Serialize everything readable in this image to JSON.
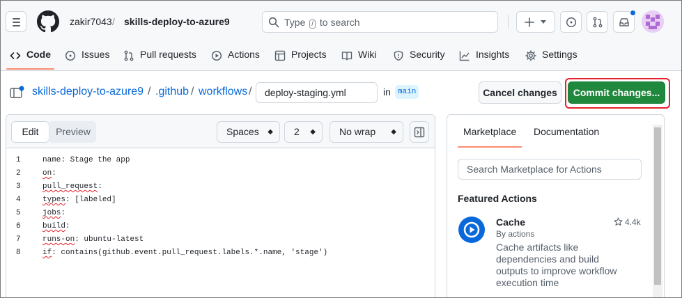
{
  "header": {
    "owner": "zakir7043",
    "separator": "/",
    "repo": "skills-deploy-to-azure9",
    "search_prefix": "Type",
    "search_key": "/",
    "search_suffix": "to search"
  },
  "repo_nav": {
    "items": [
      {
        "label": "Code",
        "icon": "code-icon"
      },
      {
        "label": "Issues",
        "icon": "issue-icon"
      },
      {
        "label": "Pull requests",
        "icon": "pull-request-icon"
      },
      {
        "label": "Actions",
        "icon": "play-icon"
      },
      {
        "label": "Projects",
        "icon": "table-icon"
      },
      {
        "label": "Wiki",
        "icon": "book-icon"
      },
      {
        "label": "Security",
        "icon": "shield-icon"
      },
      {
        "label": "Insights",
        "icon": "graph-icon"
      },
      {
        "label": "Settings",
        "icon": "gear-icon"
      }
    ]
  },
  "path": {
    "repo": "skills-deploy-to-azure9",
    "sep": "/",
    "dir1": ".github",
    "dir2": "workflows",
    "filename": "deploy-staging.yml",
    "in_label": "in",
    "branch": "main"
  },
  "actions": {
    "cancel": "Cancel changes",
    "commit": "Commit changes..."
  },
  "editor": {
    "tab_edit": "Edit",
    "tab_preview": "Preview",
    "indent_mode": "Spaces",
    "indent_size": "2",
    "wrap_mode": "No wrap",
    "lines": [
      {
        "num": "1",
        "pre": "name: Stage the app",
        "err": "",
        "post": ""
      },
      {
        "num": "2",
        "pre": "",
        "err": "on",
        "post": ":"
      },
      {
        "num": "3",
        "pre": "",
        "err": "pull_request",
        "post": ":"
      },
      {
        "num": "4",
        "pre": "",
        "err": "types",
        "post": ": [labeled]"
      },
      {
        "num": "5",
        "pre": "",
        "err": "jobs",
        "post": ":"
      },
      {
        "num": "6",
        "pre": "",
        "err": "build",
        "post": ":"
      },
      {
        "num": "7",
        "pre": "",
        "err": "runs-on",
        "post": ": ubuntu-latest"
      },
      {
        "num": "8",
        "pre": "",
        "err": "if",
        "post": ": contains(github.event.pull_request.labels.*.name, 'stage')"
      }
    ]
  },
  "panel": {
    "tab_marketplace": "Marketplace",
    "tab_documentation": "Documentation",
    "search_placeholder": "Search Marketplace for Actions",
    "featured_heading": "Featured Actions",
    "featured": {
      "title": "Cache",
      "by": "By actions",
      "stars": "4.4k",
      "description": "Cache artifacts like dependencies and build outputs to improve workflow execution time"
    }
  },
  "colors": {
    "accent_blue": "#0969da",
    "commit_green": "#1f883d",
    "highlight_red": "#e5202a",
    "tab_underline": "#fd8c73"
  }
}
